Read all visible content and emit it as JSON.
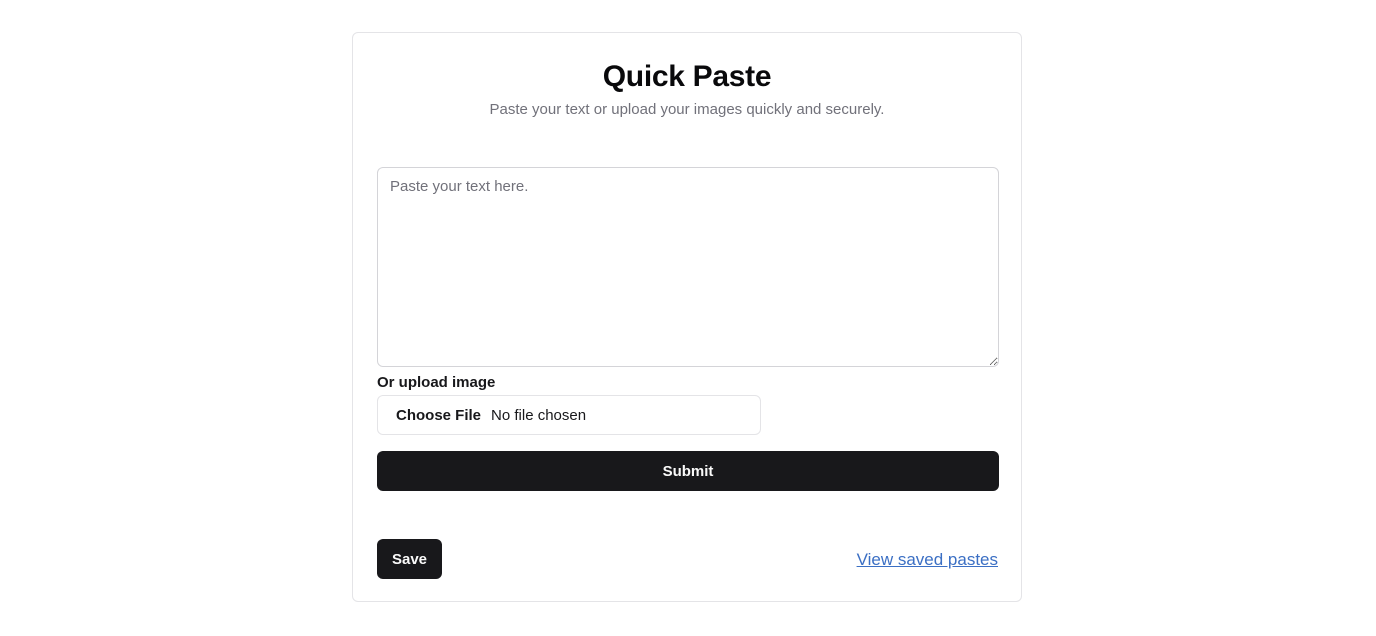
{
  "header": {
    "title": "Quick Paste",
    "subtitle": "Paste your text or upload your images quickly and securely."
  },
  "form": {
    "text_placeholder": "Paste your text here.",
    "text_value": "",
    "upload_label": "Or upload image",
    "choose_file_label": "Choose File",
    "file_status": "No file chosen",
    "submit_label": "Submit"
  },
  "footer": {
    "save_label": "Save",
    "view_saved_label": "View saved pastes"
  },
  "colors": {
    "primary_button": "#18181b",
    "link": "#3b6fc4",
    "muted_text": "#71717a",
    "border": "#e4e4e7"
  }
}
